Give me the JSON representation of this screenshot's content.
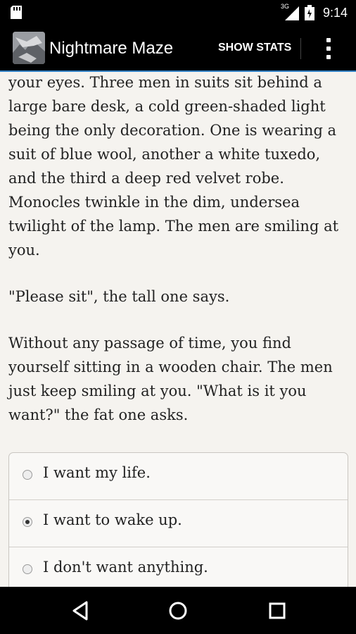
{
  "status_bar": {
    "network_type": "3G",
    "time": "9:14"
  },
  "app_bar": {
    "title": "Nightmare Maze",
    "show_stats_label": "SHOW STATS"
  },
  "story": {
    "paragraphs": [
      "your eyes. Three men in suits sit behind a large bare desk, a cold green-shaded light being the only decoration. One is wearing a suit of blue wool, another a white tuxedo, and the third a deep red velvet robe. Monocles twinkle in the dim, undersea twilight of the lamp. The men are smiling at you.",
      "\"Please sit\", the tall one says.",
      "Without any passage of time, you find yourself sitting in a wooden chair. The men just keep smiling at you. \"What is it you want?\" the fat one asks."
    ]
  },
  "choices": [
    {
      "label": "I want my life.",
      "selected": false
    },
    {
      "label": "I want to wake up.",
      "selected": true
    },
    {
      "label": "I don't want anything.",
      "selected": false
    }
  ],
  "colors": {
    "accent": "#2f7fc4",
    "background": "#f5f3ef",
    "bar": "#000000"
  },
  "icons": [
    "sd-card-icon",
    "signal-icon",
    "battery-icon",
    "overflow-menu-icon",
    "back-icon",
    "home-icon",
    "recents-icon"
  ]
}
